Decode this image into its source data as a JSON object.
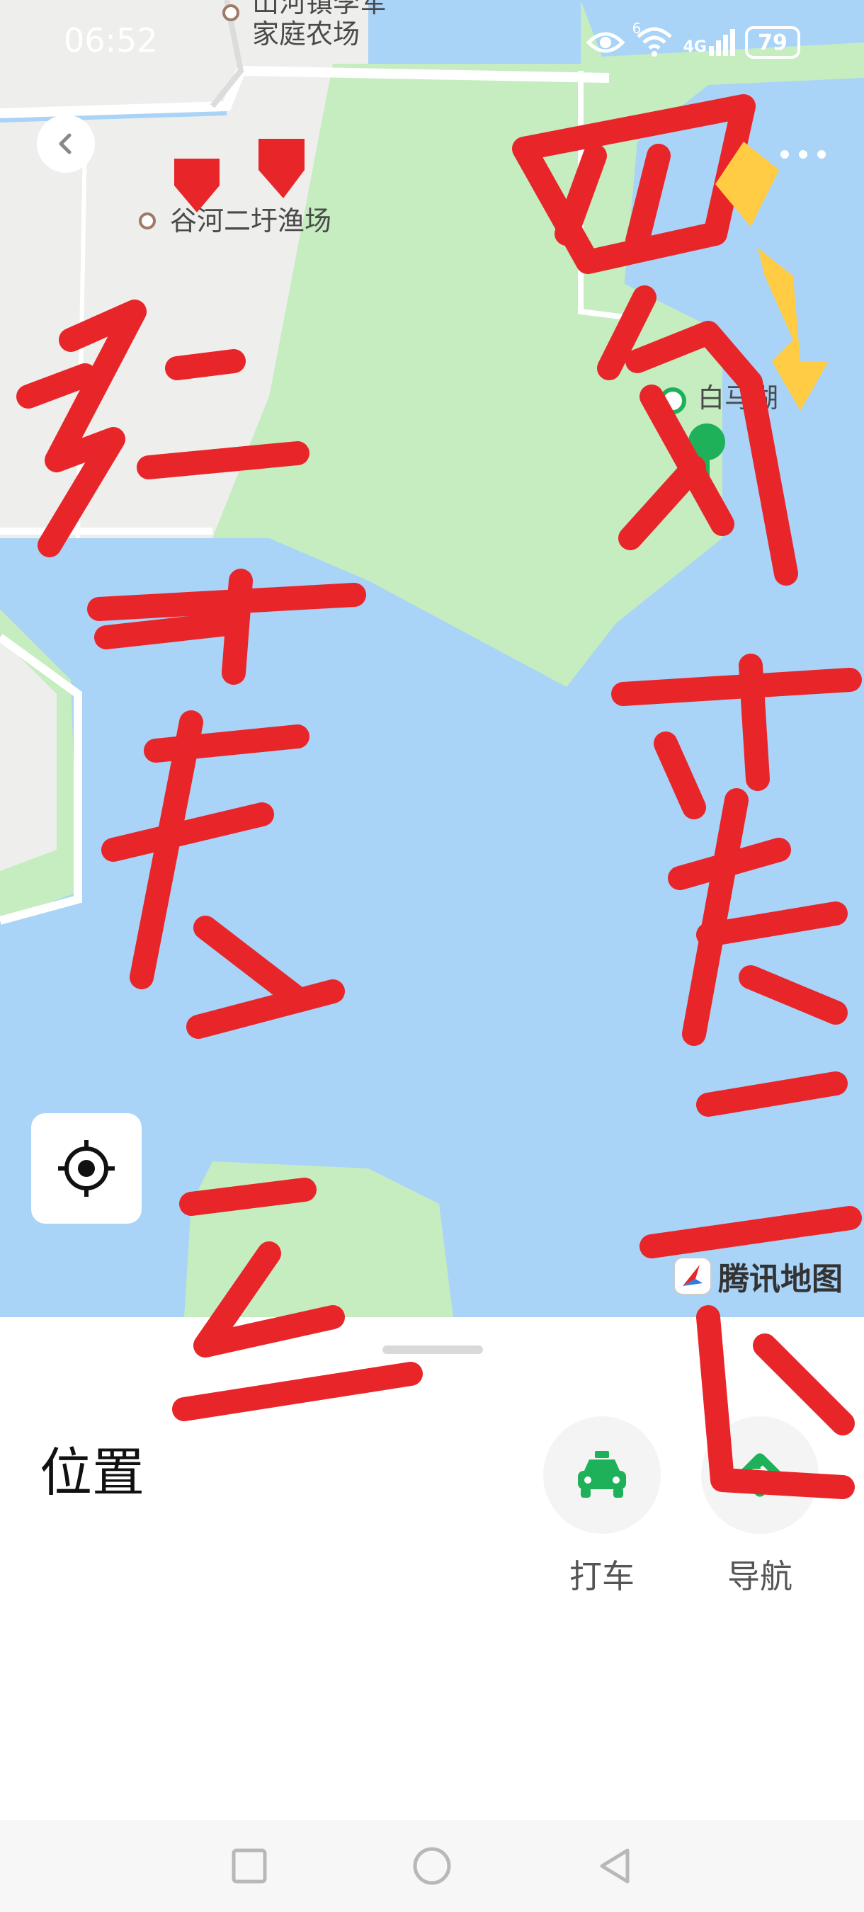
{
  "status_bar": {
    "time": "06:52",
    "network": "4G",
    "wifi_badge": "6",
    "battery": "79"
  },
  "map": {
    "labels": [
      {
        "text": "山河镇李军\n家庭农场",
        "id": "farm"
      },
      {
        "text": "谷河二圩渔场",
        "id": "fishery"
      },
      {
        "text": "白马湖",
        "id": "lake"
      }
    ],
    "watermark": "腾讯地图",
    "colors": {
      "water": "#a9d3f7",
      "land": "#c5edc0",
      "urban": "#eeeeec",
      "road": "#ffffff"
    }
  },
  "sheet": {
    "title": "位置",
    "actions": [
      {
        "label": "打车",
        "icon": "taxi-icon"
      },
      {
        "label": "导航",
        "icon": "navigation-icon"
      }
    ]
  },
  "annotation": {
    "left_text": "红芒袋区",
    "right_text": "四角开芒发区",
    "stroke_color": "#e8262a",
    "arrow_colors": {
      "red": "#e8262a",
      "yellow": "#ffcc44"
    }
  }
}
